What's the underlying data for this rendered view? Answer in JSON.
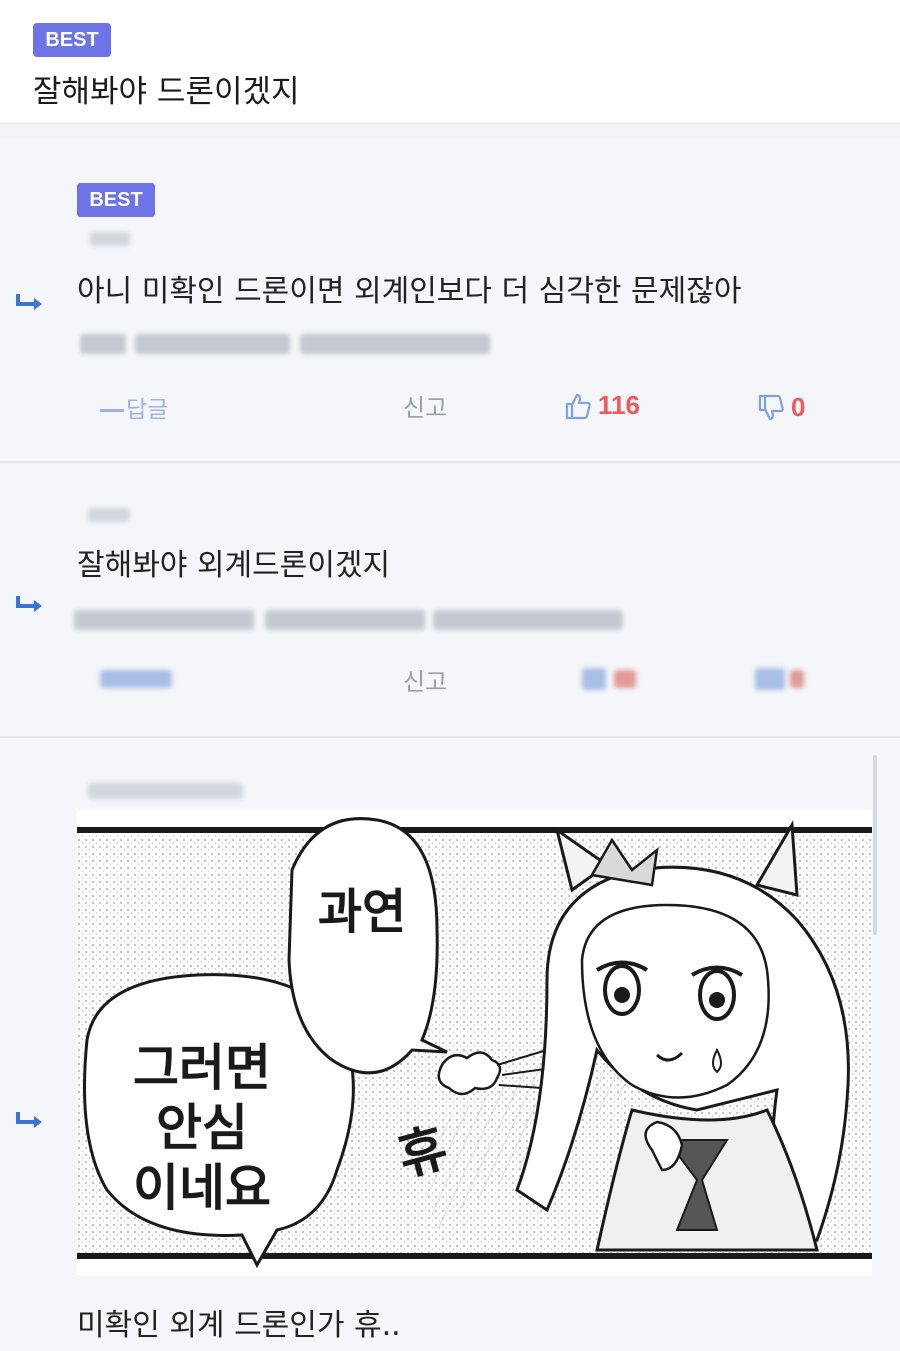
{
  "header": {
    "badge": "BEST",
    "title": "잘해봐야 드론이겠지"
  },
  "comments": [
    {
      "badge": "BEST",
      "text": "아니 미확인 드론이면 외계인보다 더 심각한 문제잖아",
      "reply_label": "답글",
      "report_label": "신고",
      "likes": "116",
      "dislikes": "0"
    },
    {
      "text": "잘해봐야 외계드론이겠지",
      "report_label": "신고"
    },
    {
      "image_text": [
        "과연",
        "그러면",
        "안심",
        "이네요",
        "휴"
      ],
      "caption": "미확인 외계 드론인가 휴.."
    }
  ],
  "colors": {
    "badge": "#6c74e8",
    "like": "#ee5a5a",
    "dislike_icon": "#7fa0e6",
    "reply_arrow": "#3c74d6",
    "panel_bg": "#f4f6f9"
  }
}
